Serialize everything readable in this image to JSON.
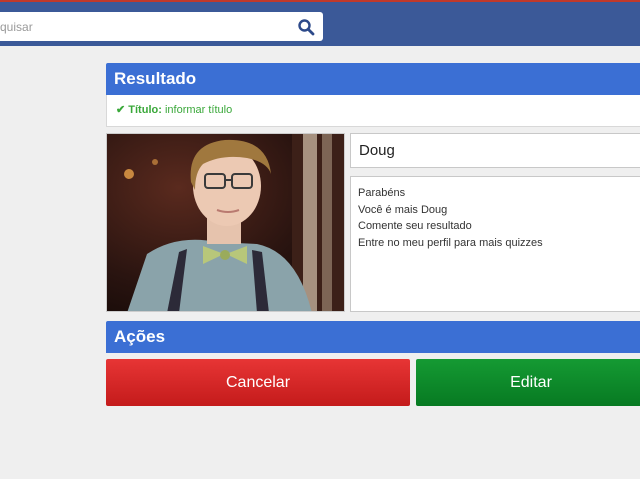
{
  "header": {
    "search": {
      "placeholder": "quisar"
    }
  },
  "result": {
    "section_title": "Resultado",
    "title_field": {
      "label": "Título:",
      "value": "informar título"
    },
    "name": "Doug",
    "description_lines": [
      "Parabéns",
      "Você é mais Doug",
      "Comente seu resultado",
      "Entre no meu perfil para mais quizzes"
    ]
  },
  "actions": {
    "section_title": "Ações",
    "cancel_label": "Cancelar",
    "edit_label": "Editar"
  },
  "colors": {
    "topbar": "#3b5998",
    "section_header": "#3b6fd4",
    "success_green": "#3aa83a",
    "cancel_red": "#d42a2a",
    "edit_green": "#0e8a2b"
  }
}
